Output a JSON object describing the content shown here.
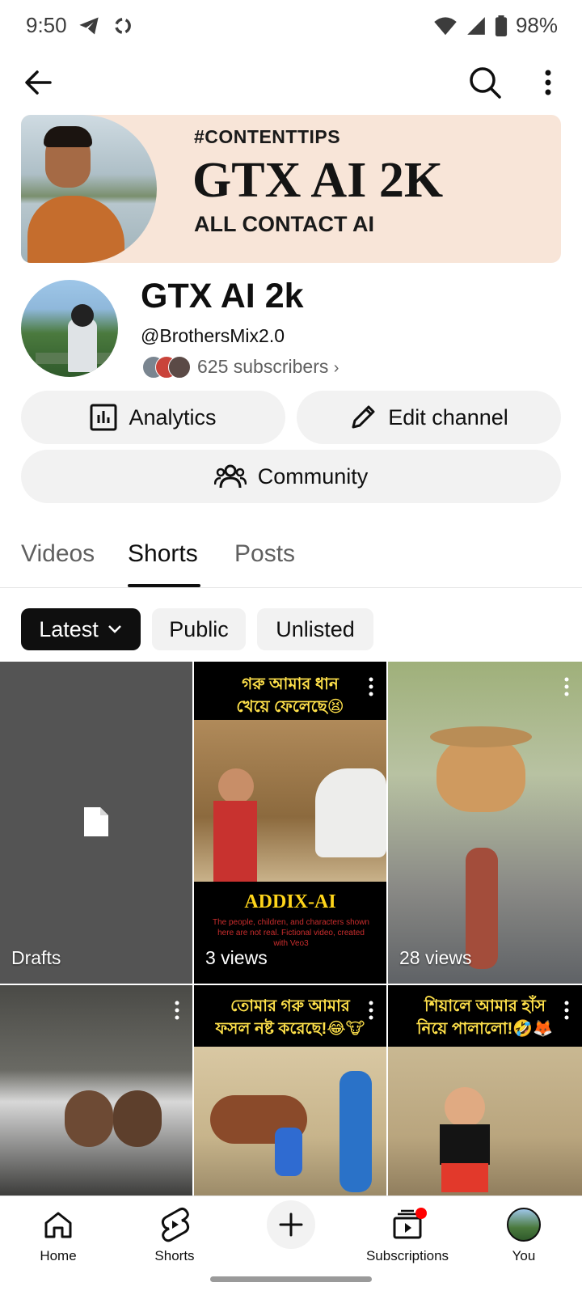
{
  "status_bar": {
    "time": "9:50",
    "battery": "98%"
  },
  "banner": {
    "tag": "#CONTENTTIPS",
    "title": "GTX AI 2K",
    "subtitle": "ALL CONTACT AI"
  },
  "channel": {
    "name": "GTX AI 2k",
    "handle": "@BrothersMix2.0",
    "subscribers": "625 subscribers"
  },
  "actions": {
    "analytics": "Analytics",
    "edit_channel": "Edit channel",
    "community": "Community"
  },
  "tabs": [
    {
      "label": "Videos",
      "active": false
    },
    {
      "label": "Shorts",
      "active": true
    },
    {
      "label": "Posts",
      "active": false
    }
  ],
  "filters": {
    "selected": "Latest",
    "options": [
      "Public",
      "Unlisted"
    ]
  },
  "shorts": [
    {
      "label": "Drafts",
      "kind": "drafts"
    },
    {
      "label": "3 views",
      "caption_top": "গরু আমার ধান\nখেয়ে ফেলেছে😫",
      "brand": "ADDIX-AI",
      "disclaimer": "The people, children, and characters shown here are not real. Fictional video, created with Veo3"
    },
    {
      "label": "28 views"
    },
    {
      "label": ""
    },
    {
      "label": "",
      "caption_top": "তোমার গরু আমার\nফসল নষ্ট করেছে!😂🐮"
    },
    {
      "label": "",
      "caption_top": "শিয়ালে আমার হাঁস\nনিয়ে পালালো!🤣🦊"
    }
  ],
  "bottom_nav": {
    "home": "Home",
    "shorts": "Shorts",
    "subscriptions": "Subscriptions",
    "you": "You"
  },
  "colors": {
    "accent_red": "#ff0000",
    "chip_selected": "#0f0f0f",
    "chip_bg": "#f2f2f2",
    "caption_yellow": "#ffe14a"
  }
}
